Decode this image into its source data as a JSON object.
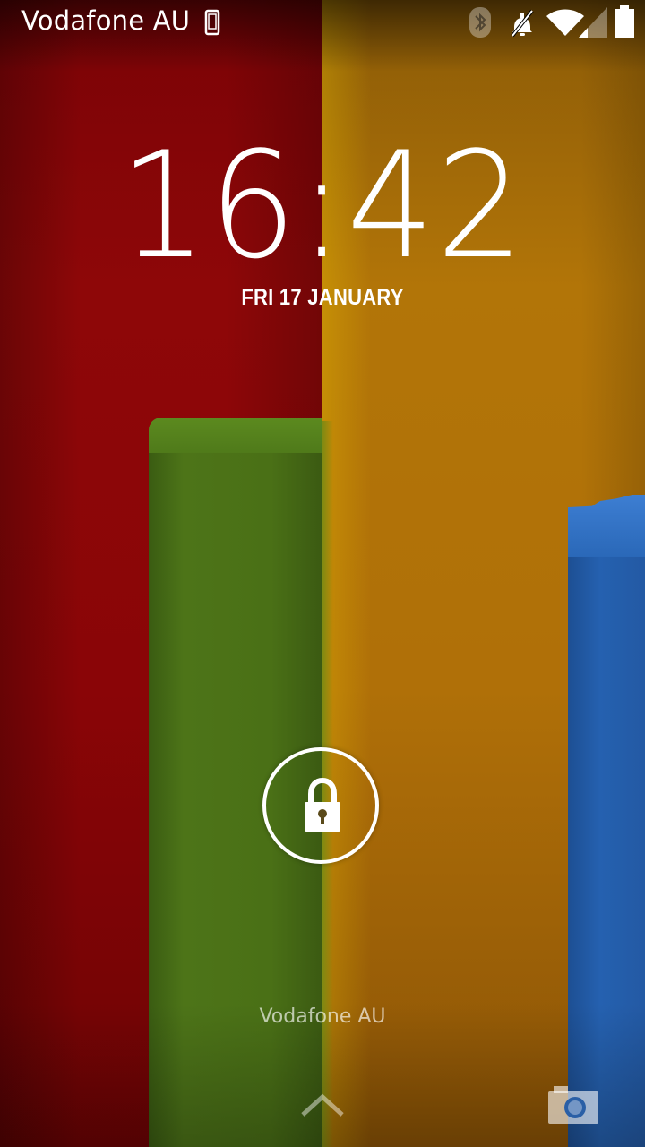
{
  "status_bar": {
    "carrier": "Vodafone AU",
    "icons": [
      "phone-icon",
      "bluetooth-icon",
      "mute-icon",
      "wifi-icon",
      "signal-icon",
      "battery-icon"
    ]
  },
  "lockscreen": {
    "time": "16:42",
    "date": "FRI 17 JANUARY",
    "carrier": "Vodafone AU",
    "unlock_icon": "lock-icon",
    "bottom_icons": [
      "chevron-up-icon",
      "camera-icon"
    ]
  },
  "colors": {
    "wallpaper_red": "#8e0708",
    "wallpaper_yellow": "#b27508",
    "wallpaper_green": "#4d7418",
    "wallpaper_blue": "#2561b0",
    "text": "#ffffff"
  }
}
